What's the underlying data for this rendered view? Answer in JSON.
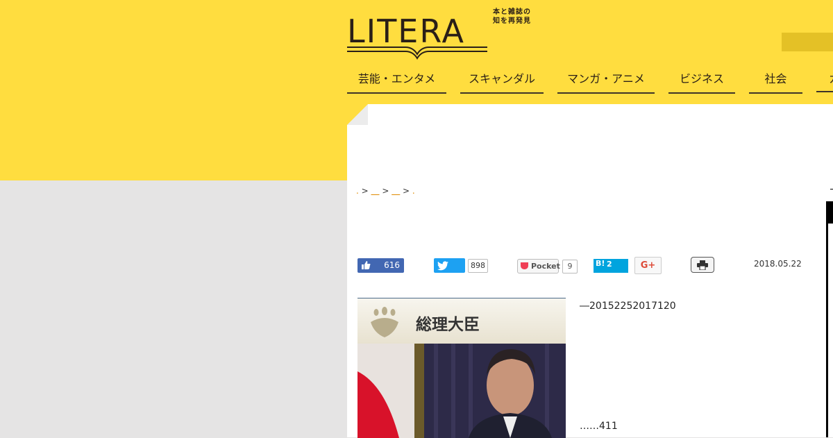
{
  "header": {
    "logo_text": "LITERA",
    "tagline_line1": "本と雑誌の",
    "tagline_line2": "知を再発見"
  },
  "nav": {
    "items": [
      {
        "label": "芸能・エンタメ"
      },
      {
        "label": "スキャンダル"
      },
      {
        "label": "マンガ・アニメ"
      },
      {
        "label": "ビジネス"
      },
      {
        "label": "社会"
      },
      {
        "label": "カ"
      }
    ]
  },
  "breadcrumb": {
    "start": ".",
    "sep1": " > ",
    "link1": "＿",
    "sep2": " > ",
    "link2": "＿",
    "sep3": " > ",
    "end": "."
  },
  "social": {
    "facebook_count": "616",
    "twitter_count": "898",
    "pocket_label": "Pocket",
    "pocket_count": "9",
    "hatena_icon": "B!",
    "hatena_count": "2",
    "gplus_label": "G+"
  },
  "article": {
    "date": "2018.05.22",
    "image_title": "総理大臣",
    "text_1": "―20152252017120",
    "text_2": "……411"
  },
  "colors": {
    "brand_yellow": "#ffdd3f",
    "link_orange": "#e08a00",
    "facebook": "#4267b2",
    "twitter": "#1da1f2",
    "hatena": "#00a4de"
  }
}
